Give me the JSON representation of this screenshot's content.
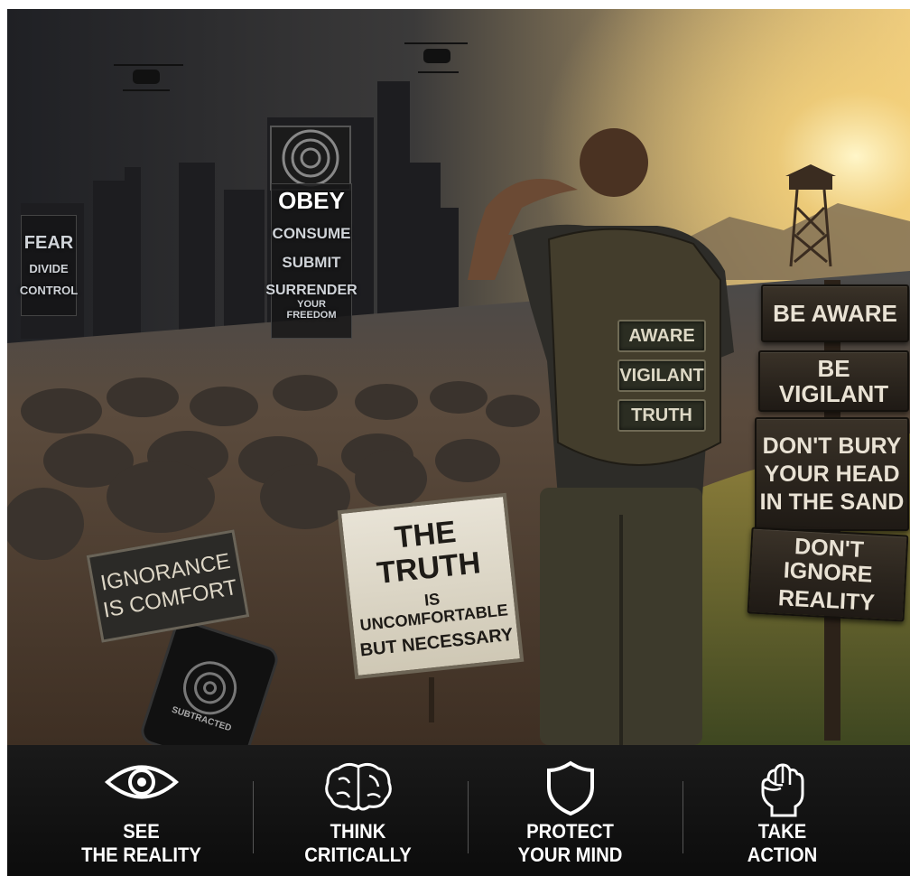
{
  "city": {
    "fear_sign": [
      "FEAR",
      "DIVIDE",
      "CONTROL"
    ],
    "billboard": [
      "OBEY",
      "CONSUME",
      "SUBMIT",
      "SURRENDER",
      "YOUR FREEDOM"
    ]
  },
  "foreground": {
    "ignorance_sign": [
      "IGNORANCE",
      "IS COMFORT"
    ],
    "truth_sign": [
      "THE TRUTH",
      "IS UNCOMFORTABLE",
      "BUT NECESSARY"
    ],
    "phone_screen_text": "SUBTRACTED"
  },
  "backpack_patches": [
    "AWARE",
    "VIGILANT",
    "TRUTH"
  ],
  "signpost": [
    [
      "BE AWARE"
    ],
    [
      "BE VIGILANT"
    ],
    [
      "DON'T BURY",
      "YOUR HEAD",
      "IN THE SAND"
    ],
    [
      "DON'T IGNORE",
      "REALITY"
    ]
  ],
  "bottom_bar": [
    {
      "icon": "eye-icon",
      "line1": "SEE",
      "line2": "THE REALITY"
    },
    {
      "icon": "brain-icon",
      "line1": "THINK",
      "line2": "CRITICALLY"
    },
    {
      "icon": "shield-icon",
      "line1": "PROTECT",
      "line2": "YOUR MIND"
    },
    {
      "icon": "raised-fist-icon",
      "line1": "TAKE",
      "line2": "ACTION"
    }
  ],
  "colors": {
    "sky_dark": "#2a2a2e",
    "sunlight": "#f6d27a",
    "ground": "#5a4636",
    "bar_background": "#121212",
    "bar_text": "#ffffff"
  }
}
